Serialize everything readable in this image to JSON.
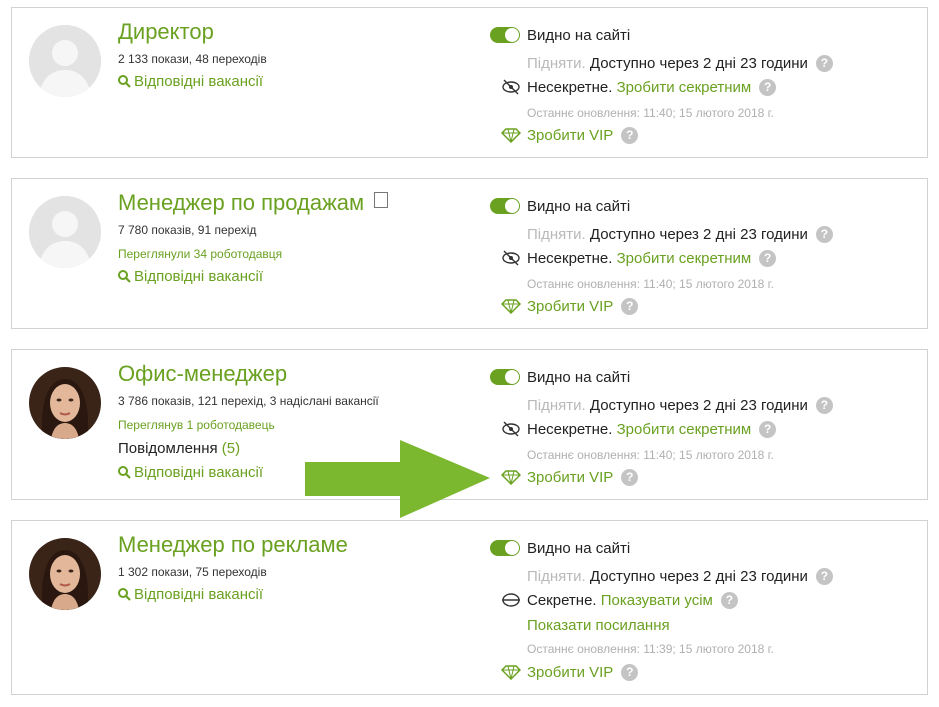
{
  "cards": [
    {
      "title": "Директор",
      "stats": "2 133 покази, 48 переходів",
      "jobs_link": "Відповідні вакансії",
      "visibility_label": "Видно на сайті",
      "raise_label": "Підняти.",
      "raise_available": "Доступно через 2 дні 23 години",
      "secret_status": "Несекретне.",
      "secret_action": "Зробити секретним",
      "updated": "Останнє оновлення: 11:40; 15 лютого 2018 г.",
      "vip_label": "Зробити VIP"
    },
    {
      "title": "Менеджер по продажам",
      "stats": "7 780 показів, 91 перехід",
      "viewed": "Переглянули 34 роботодавця",
      "jobs_link": "Відповідні вакансії",
      "visibility_label": "Видно на сайті",
      "raise_label": "Підняти.",
      "raise_available": "Доступно через 2 дні 23 години",
      "secret_status": "Несекретне.",
      "secret_action": "Зробити секретним",
      "updated": "Останнє оновлення: 11:40; 15 лютого 2018 г.",
      "vip_label": "Зробити VIP"
    },
    {
      "title": "Офис-менеджер",
      "stats": "3 786 показів, 121 перехід, 3 надіслані вакансії",
      "viewed": "Переглянув 1 роботодавець",
      "messages_label": "Повідомлення",
      "messages_count": "(5)",
      "jobs_link": "Відповідні вакансії",
      "visibility_label": "Видно на сайті",
      "raise_label": "Підняти.",
      "raise_available": "Доступно через 2 дні 23 години",
      "secret_status": "Несекретне.",
      "secret_action": "Зробити секретним",
      "updated": "Останнє оновлення: 11:40; 15 лютого 2018 г.",
      "vip_label": "Зробити VIP"
    },
    {
      "title": "Менеджер по рекламе",
      "stats": "1 302 покази, 75 переходів",
      "jobs_link": "Відповідні вакансії",
      "visibility_label": "Видно на сайті",
      "raise_label": "Підняти.",
      "raise_available": "Доступно через 2 дні 23 години",
      "secret_status": "Секретне.",
      "secret_action": "Показувати усім",
      "show_links": "Показати посилання",
      "updated": "Останнє оновлення: 11:39; 15 лютого 2018 г.",
      "vip_label": "Зробити VIP"
    }
  ],
  "help_glyph": "?",
  "icons": {
    "avatar_placeholder": "person-silhouette-icon",
    "avatar_photo": "user-photo-avatar",
    "search": "search-icon",
    "document": "document-icon",
    "toggle": "toggle-on-icon",
    "eye_crossed": "not-secret-icon",
    "eye": "secret-icon",
    "diamond": "diamond-icon",
    "help": "help-icon",
    "arrow": "green-arrow-annotation"
  },
  "colors": {
    "accent": "#6aa121",
    "muted": "#b9b9b9",
    "border": "#d2d2d2",
    "help": "#c4c4c4"
  }
}
